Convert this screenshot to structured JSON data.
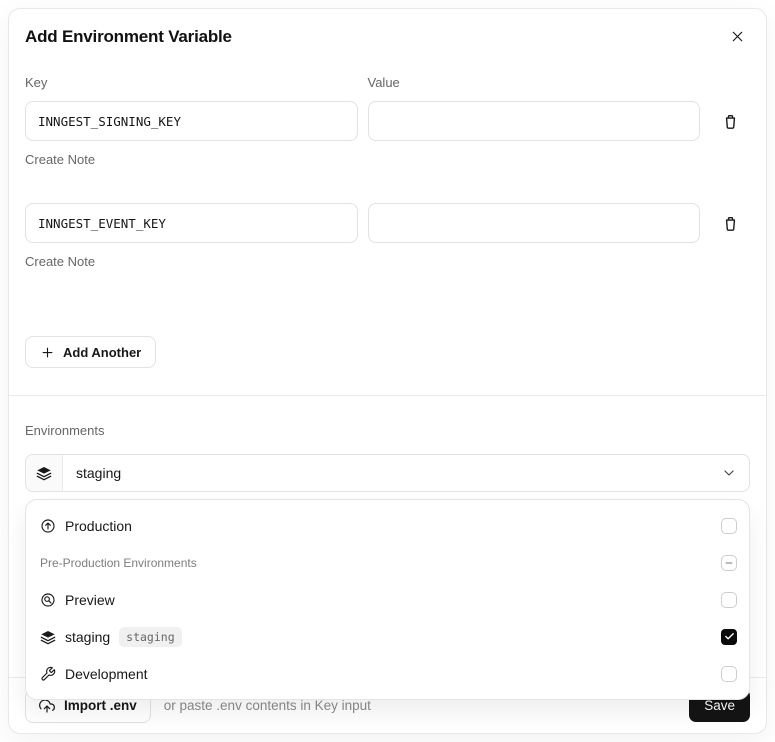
{
  "modal": {
    "title": "Add Environment Variable"
  },
  "form": {
    "key_label": "Key",
    "value_label": "Value",
    "rows": [
      {
        "key": "INNGEST_SIGNING_KEY",
        "value": "",
        "note_label": "Create Note"
      },
      {
        "key": "INNGEST_EVENT_KEY",
        "value": "",
        "note_label": "Create Note"
      }
    ],
    "add_another_label": "Add Another"
  },
  "environments": {
    "label": "Environments",
    "selected_value": "staging",
    "options": [
      {
        "label": "Production",
        "icon": "arrow-up-circle-icon",
        "checked": false
      },
      {
        "label": "Pre-Production Environments",
        "type": "group-header",
        "state": "indeterminate"
      },
      {
        "label": "Preview",
        "icon": "magnifier-circle-icon",
        "checked": false
      },
      {
        "label": "staging",
        "icon": "layers-icon",
        "badge": "staging",
        "checked": true
      },
      {
        "label": "Development",
        "icon": "wrench-icon",
        "checked": false
      }
    ]
  },
  "footer": {
    "import_label": "Import .env",
    "hint": "or paste .env contents in Key input",
    "save_label": "Save"
  },
  "icons": {
    "close": "x-icon",
    "row_delete": "trash-icon",
    "add": "plus-icon",
    "select_left": "layers-icon",
    "select_right": "chevron-down-icon",
    "import": "upload-cloud-icon",
    "checked": "check-icon",
    "indeterminate": "minus-icon"
  },
  "colors": {
    "accent_dark": "#0a0a0a",
    "border": "#e2e2e2",
    "muted_text": "#666666",
    "badge_bg": "#f0f0f0",
    "icon_cell_bg": "#fafafa"
  }
}
